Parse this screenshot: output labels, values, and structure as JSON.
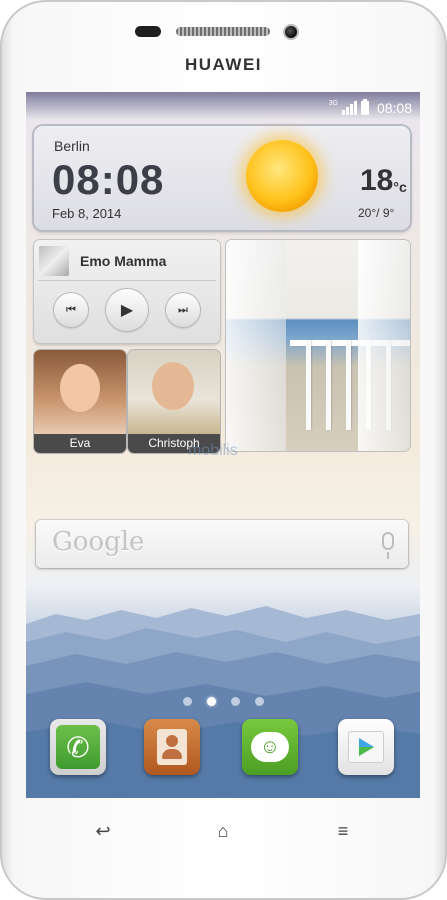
{
  "device": {
    "brand": "HUAWEI"
  },
  "status_bar": {
    "network": "3G",
    "time": "08:08",
    "icons": [
      "signal-icon",
      "battery-icon"
    ]
  },
  "weather_widget": {
    "city": "Berlin",
    "time": "08:08",
    "date": "Feb 8, 2014",
    "temperature": "18",
    "unit": "°c",
    "range": "20°/ 9°",
    "condition_icon": "sun-icon"
  },
  "music_widget": {
    "track": "Emo Mamma",
    "controls": {
      "previous": "⏮",
      "play": "▶",
      "next": "⏭"
    }
  },
  "contacts": [
    {
      "name": "Eva"
    },
    {
      "name": "Christoph"
    }
  ],
  "watermark": "mobilis",
  "search_bar": {
    "logo": "Google",
    "mic_icon": "microphone-icon"
  },
  "home_pages": {
    "count": 4,
    "active_index": 1
  },
  "dock": [
    {
      "label": "Phone",
      "icon": "phone-icon",
      "color": "#3f9b2f"
    },
    {
      "label": "Contacts",
      "icon": "contacts-icon",
      "color": "#c06a2b"
    },
    {
      "label": "Messaging",
      "icon": "message-icon",
      "color": "#5aae2c"
    },
    {
      "label": "Play Store",
      "icon": "play-store-icon",
      "color": "#f4f4f4"
    }
  ],
  "nav_keys": {
    "back": "↩",
    "home": "⌂",
    "menu": "≡"
  },
  "colors": {
    "phone_body": "#ffffff",
    "sun": "#ffc21a",
    "nav_text": "#444444"
  }
}
